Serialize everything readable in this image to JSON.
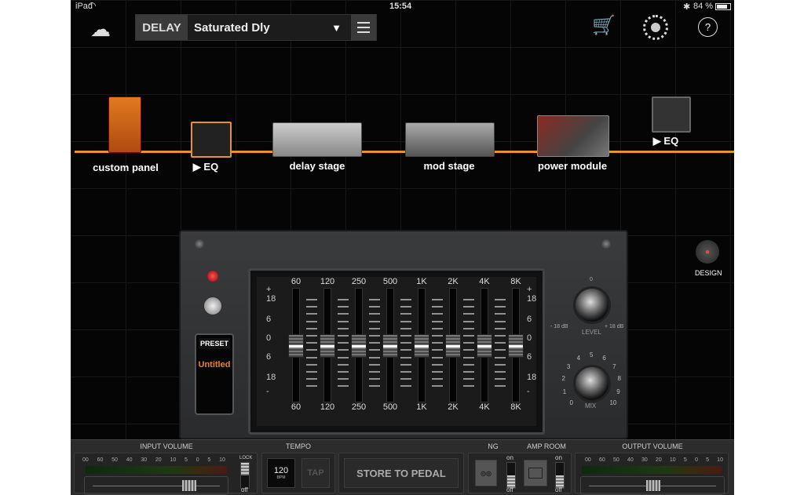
{
  "status": {
    "device": "iPad",
    "time": "15:54",
    "battery": "84 %"
  },
  "header": {
    "category": "DELAY",
    "preset_name": "Saturated Dly"
  },
  "colors": {
    "accent": "#e8922a",
    "preset_text": "#e8822a",
    "background": "#050505"
  },
  "chain": {
    "modules": [
      {
        "label": "custom panel"
      },
      {
        "label": "▶ EQ",
        "selected": true
      },
      {
        "label": "delay stage"
      },
      {
        "label": "mod stage"
      },
      {
        "label": "power module"
      },
      {
        "label": "▶ EQ"
      }
    ],
    "design_label": "DESIGN"
  },
  "eq": {
    "preset_label": "PRESET",
    "preset_value": "Untitled",
    "bands": [
      {
        "freq": "60",
        "gain": 0
      },
      {
        "freq": "120",
        "gain": 0
      },
      {
        "freq": "250",
        "gain": 0
      },
      {
        "freq": "500",
        "gain": 0
      },
      {
        "freq": "1K",
        "gain": 0
      },
      {
        "freq": "2K",
        "gain": 0
      },
      {
        "freq": "4K",
        "gain": 0
      },
      {
        "freq": "8K",
        "gain": 0
      }
    ],
    "scale": [
      "+",
      "18",
      "6",
      "0",
      "6",
      "18",
      "-"
    ],
    "gain_range": [
      -18,
      18
    ],
    "level": {
      "label": "LEVEL",
      "min": "- 18 dB",
      "max": "+ 18 dB",
      "center": "0",
      "value": 0
    },
    "mix": {
      "label": "MIX",
      "ticks": [
        "0",
        "1",
        "2",
        "3",
        "4",
        "5",
        "6",
        "7",
        "8",
        "9",
        "10"
      ],
      "value": 9
    }
  },
  "bottom": {
    "input_volume": {
      "label": "INPUT VOLUME",
      "scale": [
        "00",
        "60",
        "50",
        "40",
        "30",
        "20",
        "10",
        "5",
        "0",
        "5",
        "10"
      ],
      "level": 0.78,
      "lock_label": "LOCK",
      "lock_state": "off"
    },
    "tempo": {
      "label": "TEMPO",
      "bpm": "120",
      "bpm_unit": "BPM",
      "tap": "TAP"
    },
    "store": "STORE TO PEDAL",
    "ng": {
      "label": "NG",
      "on": "on",
      "off": "off"
    },
    "amp_room": {
      "label": "AMP ROOM",
      "on": "on",
      "off": "off"
    },
    "output_volume": {
      "label": "OUTPUT VOLUME",
      "scale": [
        "00",
        "60",
        "50",
        "40",
        "30",
        "20",
        "10",
        "5",
        "0",
        "5",
        "10"
      ],
      "level": 0.5
    }
  }
}
